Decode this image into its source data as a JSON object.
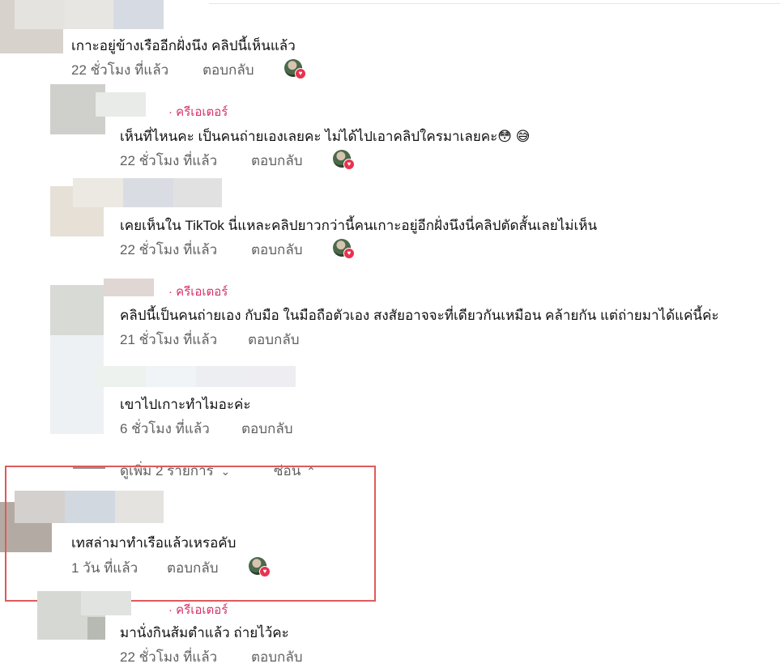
{
  "comments": [
    {
      "text": "เกาะอยู่ข้างเรืออีกฝั่งนึง คลิปนี้เห็นแล้ว",
      "time": "22 ชั่วโมง ที่แล้ว",
      "reply": "ตอบกลับ"
    },
    {
      "creator": "· ครีเอเตอร์",
      "text": "เห็นที่ไหนคะ เป็นคนถ่ายเองเลยคะ ไม่ได้ไปเอาคลิปใครมาเลยคะ😳 😅",
      "time": "22 ชั่วโมง ที่แล้ว",
      "reply": "ตอบกลับ"
    },
    {
      "text": "เคยเห็นใน TikTok นี่แหละคลิปยาวกว่านี้คนเกาะอยู่อีกฝั่งนึงนี่คลิปตัดสั้นเลยไม่เห็น",
      "time": "22 ชั่วโมง ที่แล้ว",
      "reply": "ตอบกลับ"
    },
    {
      "creator": "· ครีเอเตอร์",
      "text": "คลิปนี้เป็นคนถ่ายเอง กับมือ ในมือถือตัวเอง สงสัยอาจจะที่เดียวกันเหมือน คล้ายกัน แต่ถ่ายมาได้แค่นี้ค่ะ",
      "time": "21 ชั่วโมง ที่แล้ว",
      "reply": "ตอบกลับ"
    },
    {
      "text": "เขาไปเกาะทำไมอะค่ะ",
      "time": "6 ชั่วโมง ที่แล้ว",
      "reply": "ตอบกลับ"
    },
    {
      "text": "เทสล่ามาทำเรือแล้วเหรอคับ",
      "time": "1 วัน ที่แล้ว",
      "reply": "ตอบกลับ"
    },
    {
      "creator": "· ครีเอเตอร์",
      "text": "มานั่งกินส้มตำแล้ว ถ่ายไว้คะ",
      "time": "22 ชั่วโมง ที่แล้ว",
      "reply": "ตอบกลับ"
    }
  ],
  "more": {
    "show_more": "ดูเพิ่ม 2 รายการ",
    "hide": "ซ่อน"
  },
  "icons": {
    "heart": "heart-icon",
    "chevron_down": "chevron-down-icon",
    "chevron_up": "chevron-up-icon"
  },
  "colors": {
    "creator": "#d6336c",
    "highlight": "#e05a5a",
    "meta": "#606060"
  }
}
